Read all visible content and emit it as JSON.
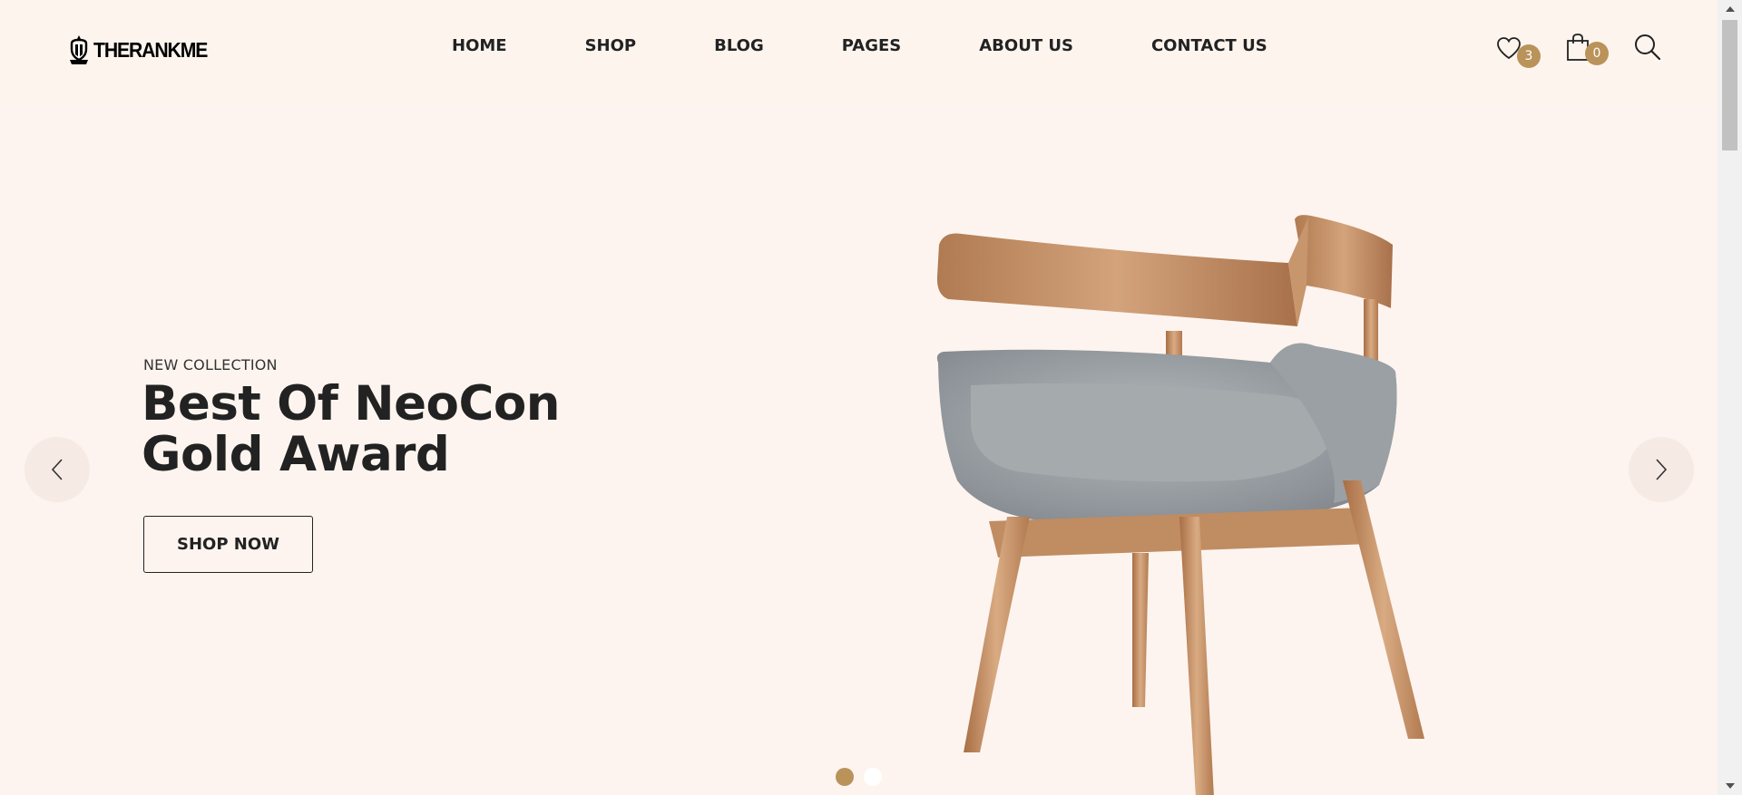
{
  "brand": {
    "logo_text": "THERANKME"
  },
  "nav": {
    "items": [
      {
        "label": "HOME"
      },
      {
        "label": "SHOP"
      },
      {
        "label": "BLOG"
      },
      {
        "label": "PAGES"
      },
      {
        "label": "ABOUT US"
      },
      {
        "label": "CONTACT US"
      }
    ]
  },
  "header_icons": {
    "wishlist_count": "3",
    "cart_count": "0"
  },
  "hero": {
    "subtitle": "NEW COLLECTION",
    "title_line1": "Best Of NeoCon",
    "title_line2": "Gold Award",
    "cta_label": "SHOP NOW"
  },
  "carousel": {
    "slide_count": 2,
    "active_index": 0
  },
  "colors": {
    "accent": "#b9935a",
    "background": "#fdf4ef",
    "text": "#222222"
  }
}
